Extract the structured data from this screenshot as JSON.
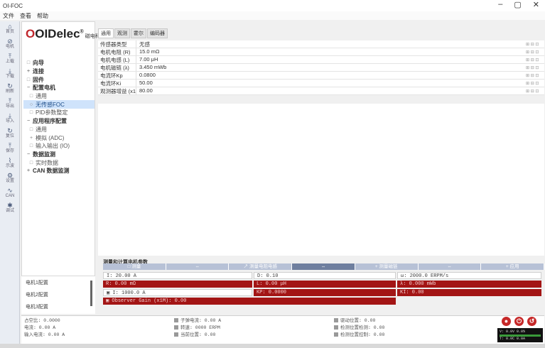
{
  "window": {
    "title": "OI-FOC",
    "minimize": "–",
    "maximize": "▢",
    "close": "✕"
  },
  "menu": [
    "文件",
    "查看",
    "帮助"
  ],
  "iconbar": [
    {
      "icon": "home-icon",
      "glyph": "⌂",
      "label": "首页"
    },
    {
      "icon": "motor-icon",
      "glyph": "⊘",
      "label": "电机"
    },
    {
      "icon": "arrow-up-icon",
      "glyph": "⤒",
      "label": "上载"
    },
    {
      "icon": "arrow-down-icon",
      "glyph": "⤓",
      "label": "下载"
    },
    {
      "icon": "refresh-icon",
      "glyph": "↻",
      "label": "刷新"
    },
    {
      "icon": "arrow-up-icon",
      "glyph": "⤒",
      "label": "导出"
    },
    {
      "icon": "arrow-down-icon",
      "glyph": "⤓",
      "label": "导入"
    },
    {
      "icon": "refresh-icon",
      "glyph": "↻",
      "label": "复位"
    },
    {
      "icon": "arrow-up-icon",
      "glyph": "⤒",
      "label": "保存"
    },
    {
      "icon": "chart-icon",
      "glyph": "⌇",
      "label": "示波"
    },
    {
      "icon": "gear-icon",
      "glyph": "⚙",
      "label": "设置"
    },
    {
      "icon": "wave-icon",
      "glyph": "∿",
      "label": "CAN"
    },
    {
      "icon": "bug-icon",
      "glyph": "✱",
      "label": "调试"
    }
  ],
  "logo": {
    "text": "OIDelec",
    "reg": "®",
    "cn": "磁电科技"
  },
  "nav": [
    {
      "label": "向导",
      "bullet": "□",
      "level": 1,
      "strong": true
    },
    {
      "label": "连接",
      "bullet": "+",
      "level": 1,
      "strong": true
    },
    {
      "label": "固件",
      "bullet": "□",
      "level": 1,
      "strong": true
    },
    {
      "label": "配置电机",
      "bullet": "−",
      "level": 1,
      "strong": true
    },
    {
      "label": "通用",
      "bullet": "□",
      "level": 2
    },
    {
      "label": "无传感FOC",
      "bullet": "○",
      "level": 2,
      "selected": true
    },
    {
      "label": "PID参数整定",
      "bullet": "□",
      "level": 2
    },
    {
      "label": "应用程序配置",
      "bullet": "−",
      "level": 1,
      "strong": true
    },
    {
      "label": "通用",
      "bullet": "□",
      "level": 2
    },
    {
      "label": "模拟 (ADC)",
      "bullet": "+",
      "level": 2
    },
    {
      "label": "输入输出 (IO)",
      "bullet": "□",
      "level": 2
    },
    {
      "label": "数据监测",
      "bullet": "−",
      "level": 1,
      "strong": true
    },
    {
      "label": "实时数据",
      "bullet": "□",
      "level": 2
    },
    {
      "label": "CAN 数据监测",
      "bullet": "+",
      "level": 1,
      "strong": true
    }
  ],
  "motors": [
    "电机1配置",
    "电机2配置",
    "电机3配置"
  ],
  "tabs": [
    {
      "label": "通用",
      "active": true
    },
    {
      "label": "观测"
    },
    {
      "label": "霍尔"
    },
    {
      "label": "编码器"
    }
  ],
  "params": [
    {
      "key": "传感器类型",
      "value": "无感"
    },
    {
      "key": "电机电阻 (R)",
      "value": "15.0 mΩ"
    },
    {
      "key": "电机电感 (L)",
      "value": "7.00 μH"
    },
    {
      "key": "电机磁链 (λ)",
      "value": "3.450 mWb"
    },
    {
      "key": "电流环Kp",
      "value": "0.0800"
    },
    {
      "key": "电流环Ki",
      "value": "50.00"
    },
    {
      "key": "观测器增益 (x1M)",
      "value": "80.00"
    }
  ],
  "row_ctl": "⊞ ⊟ ⊡",
  "hfr": {
    "title": "测量和计算电机参数",
    "tabs": [
      {
        "label": "□ 测量",
        "dark": false
      },
      {
        "label": "⇔",
        "dark": false
      },
      {
        "label": "↗ 测量电阻电感",
        "dark": false
      },
      {
        "label": "⇔",
        "dark": true
      },
      {
        "label": "+ 测量磁链",
        "dark": false
      },
      {
        "label": "⇔",
        "dark": false
      },
      {
        "label": "+ 应用",
        "dark": false
      }
    ],
    "row1": [
      "I: 20.00 A",
      "D: 0.10",
      "ω: 2000.0 ERPM/s"
    ],
    "row2": [
      "R: 0.00 mΩ",
      "L: 0.00 μH",
      "λ: 0.000 mWb"
    ],
    "row3": [
      "▣ I: 1000.0 A",
      "KP: 0.0000",
      "KI: 0.00"
    ],
    "row4": [
      "▣ Observer Gain (x1M): 0.00"
    ]
  },
  "status": {
    "col1": [
      "占空比: 0.0000",
      "电流: 0.00 A",
      "输入电流: 0.00 A"
    ],
    "col2": [
      "子弹电流: 0.00 A",
      "转速: 0000 ERPM",
      "当前位置: 0.00"
    ],
    "col3": [
      "驱动位置: 0.00",
      "检测位置检测: 0.00",
      "检测位置控制: 0.00"
    ]
  },
  "actions": {
    "stop": "●",
    "power": "⏻",
    "reset": "↺"
  },
  "meter": {
    "line1": "V: 0.0V  0.0%",
    "line2": "T: 0.0C  0.0A"
  }
}
